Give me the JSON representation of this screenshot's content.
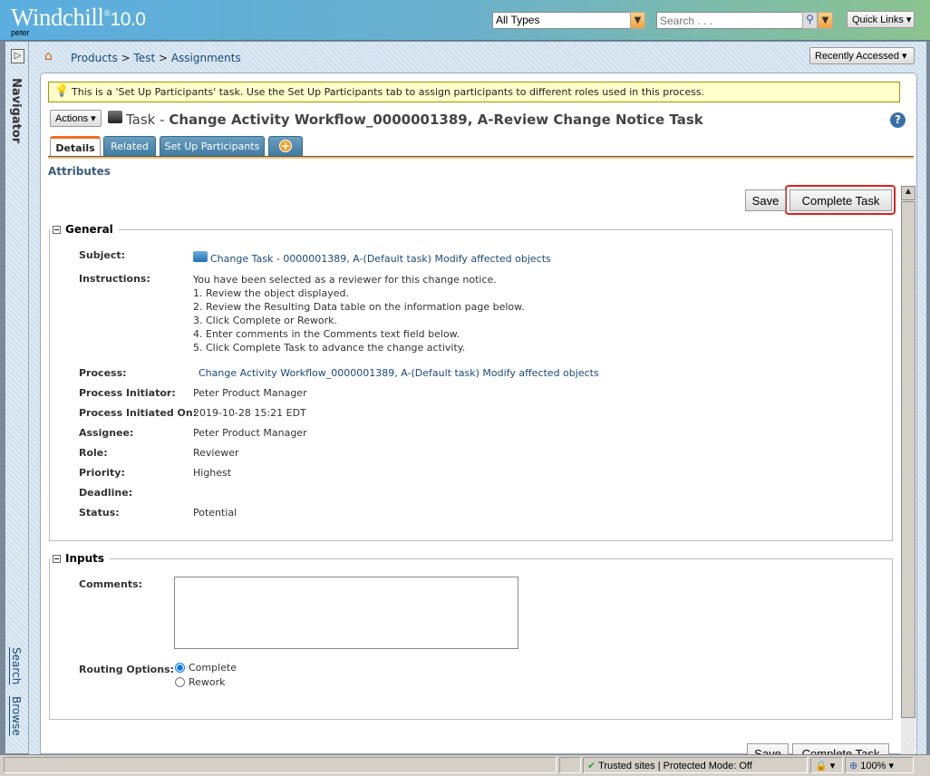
{
  "header": {
    "logo": "Windchill",
    "logo_version": "10.0",
    "user": "peter",
    "type_select": "All Types",
    "search_placeholder": "Search . . .",
    "quick_links": "Quick Links"
  },
  "navigator": {
    "label": "Navigator",
    "search": "Search",
    "browse": "Browse"
  },
  "breadcrumb": [
    "Products",
    "Test",
    "Assignments"
  ],
  "recently_accessed": "Recently Accessed",
  "banner": "This is a 'Set Up Participants' task. Use the Set Up Participants tab to assign participants to different roles used in this process.",
  "actions_label": "Actions",
  "title": {
    "prefix": "Task - ",
    "name": "Change Activity Workflow_0000001389, A-Review Change Notice Task"
  },
  "tabs": [
    {
      "label": "Details",
      "active": true
    },
    {
      "label": "Related"
    },
    {
      "label": "Set Up Participants"
    }
  ],
  "attributes_label": "Attributes",
  "buttons": {
    "save": "Save",
    "complete": "Complete Task"
  },
  "general": {
    "title": "General",
    "fields": [
      {
        "label": "Subject:",
        "value": "Change Task - 0000001389, A-(Default task) Modify affected objects",
        "link": true
      },
      {
        "label": "Instructions:",
        "lines": [
          "You have been selected as a reviewer for this change notice.",
          "1. Review the object displayed.",
          "2. Review the Resulting Data table on the information page below.",
          "3. Click Complete or Rework.",
          "4. Enter comments in the Comments text field below.",
          "5. Click Complete Task to advance the change activity."
        ]
      },
      {
        "label": "Process:",
        "value": "Change Activity Workflow_0000001389, A-(Default task) Modify affected objects",
        "link": true
      },
      {
        "label": "Process Initiator:",
        "value": "Peter Product Manager"
      },
      {
        "label": "Process Initiated On:",
        "value": "2019-10-28 15:21 EDT"
      },
      {
        "label": "Assignee:",
        "value": "Peter Product Manager"
      },
      {
        "label": "Role:",
        "value": "Reviewer"
      },
      {
        "label": "Priority:",
        "value": "Highest"
      },
      {
        "label": "Deadline:",
        "value": ""
      },
      {
        "label": "Status:",
        "value": "Potential"
      }
    ]
  },
  "inputs": {
    "title": "Inputs",
    "comments_label": "Comments:",
    "comments_value": "",
    "routing_label": "Routing Options:",
    "routing_options": [
      {
        "label": "Complete",
        "checked": true
      },
      {
        "label": "Rework",
        "checked": false
      }
    ]
  },
  "statusbar": {
    "zone": "Trusted sites | Protected Mode: Off",
    "zoom": "100%"
  },
  "colors": {
    "accent": "#f0a040",
    "link": "#1a4a7a",
    "highlight": "#e02020"
  }
}
